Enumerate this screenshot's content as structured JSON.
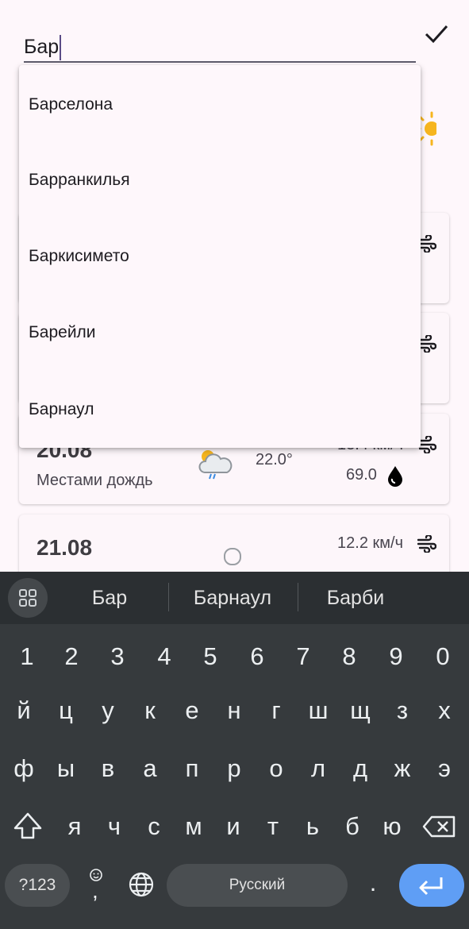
{
  "search": {
    "value": "Бар"
  },
  "suggestions": [
    "Барселона",
    "Барранкилья",
    "Баркисимето",
    "Барейли",
    "Барнаул"
  ],
  "cards": [
    {
      "date": "20.08",
      "description": "Местами дождь",
      "temp": "22.0°",
      "wind": "13.4 км/ч",
      "humidity": "69.0"
    },
    {
      "date": "21.08",
      "wind": "12.2 км/ч"
    }
  ],
  "keyboard": {
    "suggestions": [
      "Бар",
      "Барнаул",
      "Барби"
    ],
    "row_numbers": [
      "1",
      "2",
      "3",
      "4",
      "5",
      "6",
      "7",
      "8",
      "9",
      "0"
    ],
    "row1": [
      "й",
      "ц",
      "у",
      "к",
      "е",
      "н",
      "г",
      "ш",
      "щ",
      "з",
      "х"
    ],
    "row2": [
      "ф",
      "ы",
      "в",
      "а",
      "п",
      "р",
      "о",
      "л",
      "д",
      "ж",
      "э"
    ],
    "row3": [
      "я",
      "ч",
      "с",
      "м",
      "и",
      "т",
      "ь",
      "б",
      "ю"
    ],
    "symbols_label": "?123",
    "space_label": "Русский",
    "period_label": ".",
    "emoji_comma": ","
  },
  "colors": {
    "accent": "#5f9ef5",
    "keyboard_bg": "#363a3d",
    "app_bg": "#fef7fb"
  }
}
